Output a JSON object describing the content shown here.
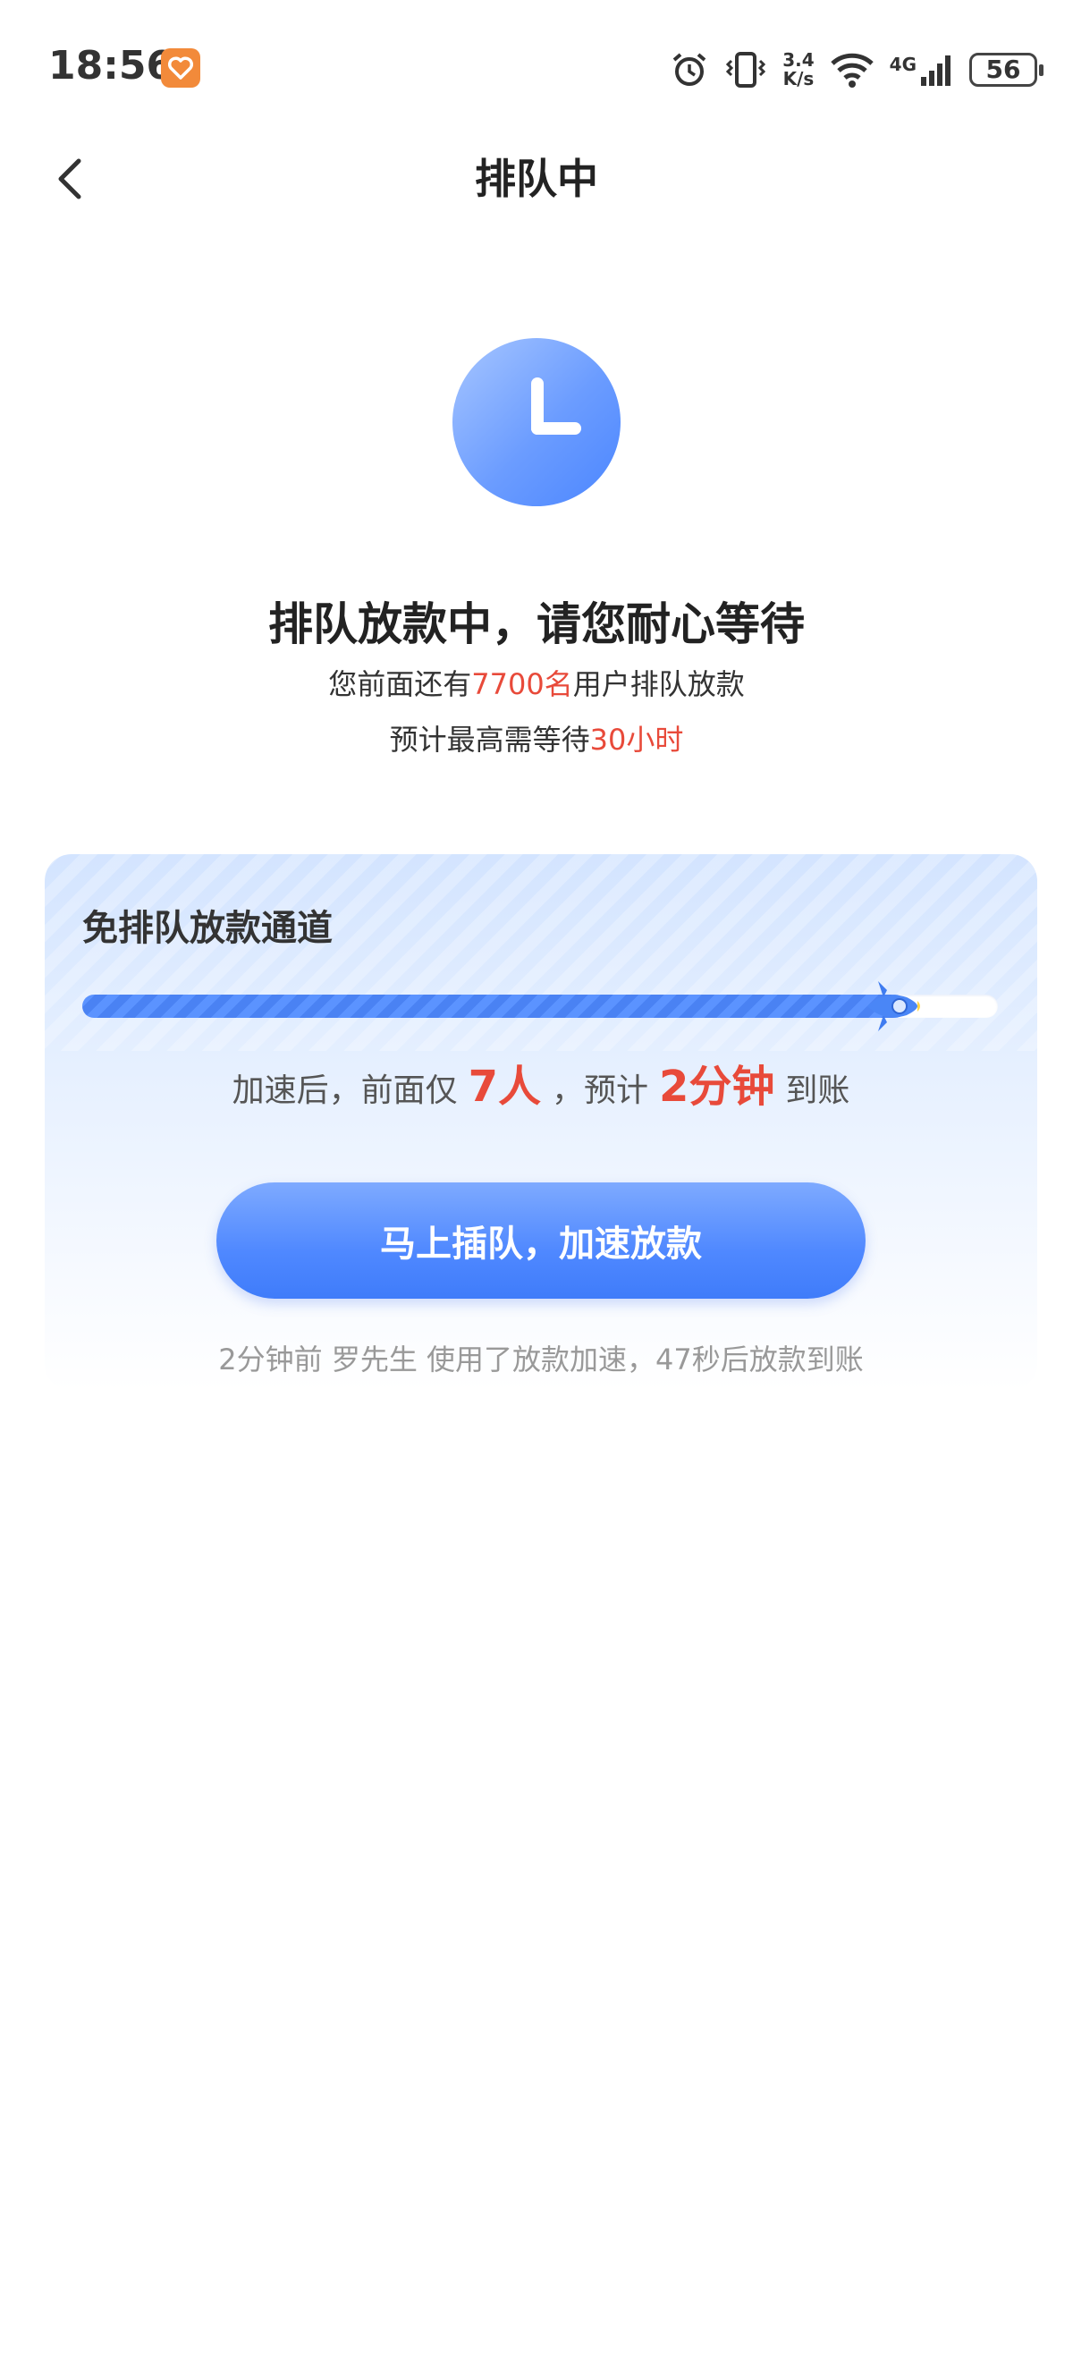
{
  "status_bar": {
    "time": "18:56",
    "speed_value": "3.4",
    "speed_unit": "K/s",
    "network": "4G",
    "battery": "56",
    "icons": [
      "app-notification-icon",
      "alarm-icon",
      "vibrate-icon",
      "wifi-icon",
      "signal-icon",
      "battery-icon"
    ]
  },
  "nav": {
    "title": "排队中",
    "back_icon": "chevron-left-icon"
  },
  "queue": {
    "headline": "排队放款中，请您耐心等待",
    "ahead_prefix": "您前面还有",
    "ahead_count": "7700名",
    "ahead_suffix": "用户排队放款",
    "wait_prefix": "预计最高需等待",
    "wait_time": "30小时"
  },
  "fast_lane": {
    "title": "免排队放款通道",
    "progress": 0.9,
    "accel_prefix": "加速后，前面仅",
    "accel_people": "7人",
    "accel_middle": "，预计",
    "accel_time": "2分钟",
    "accel_suffix": "到账",
    "button_label": "马上插队，加速放款",
    "ticker": "2分钟前 罗先生 使用了放款加速，47秒后放款到账"
  },
  "colors": {
    "accent": "#4f88ff",
    "highlight": "#e84a3a"
  }
}
